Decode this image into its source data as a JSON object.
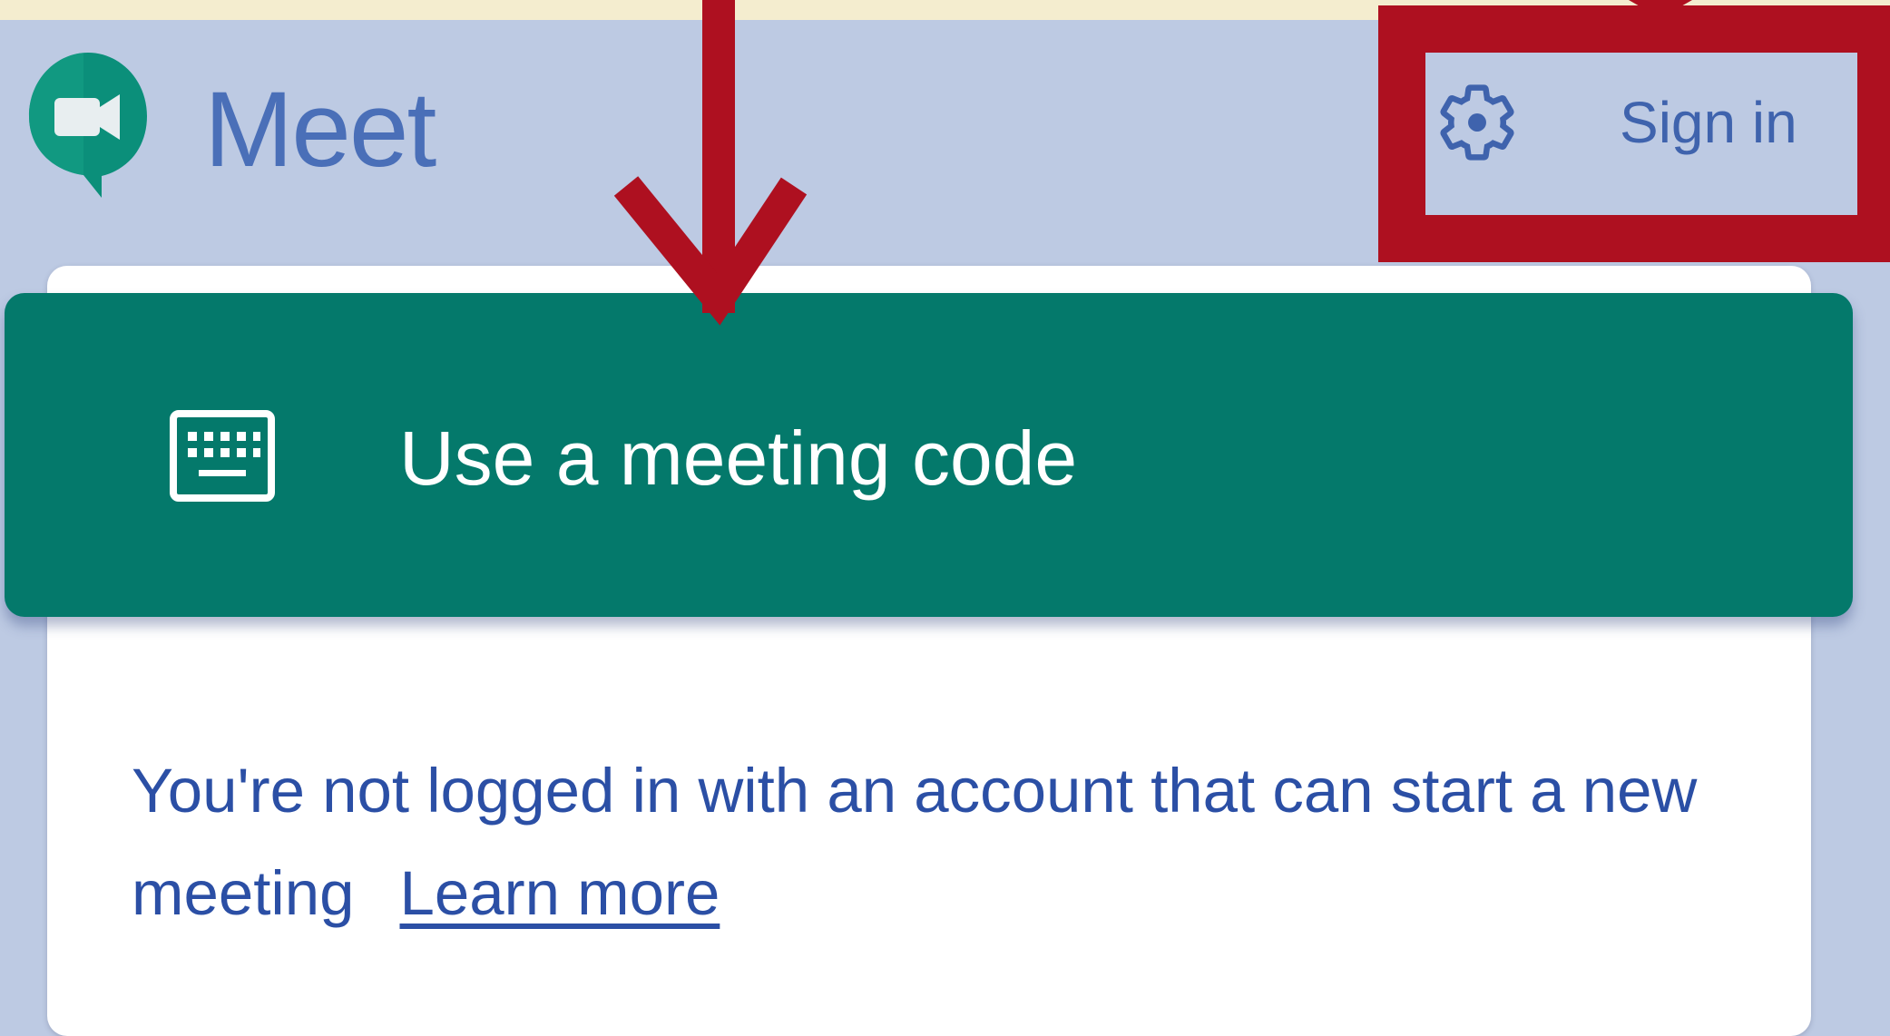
{
  "header": {
    "app_name": "Meet",
    "settings_icon": "gear-icon",
    "sign_in_label": "Sign in"
  },
  "main": {
    "meeting_code_button": {
      "icon": "keyboard-icon",
      "label": "Use a meeting code"
    },
    "info_text": "You're not logged in with an account that can start a new meeting",
    "learn_more_link": "Learn more"
  },
  "colors": {
    "background": "#bdcae3",
    "accent_green": "#04796b",
    "link_blue": "#2b4fa5",
    "annotation_red": "#ae1020"
  }
}
